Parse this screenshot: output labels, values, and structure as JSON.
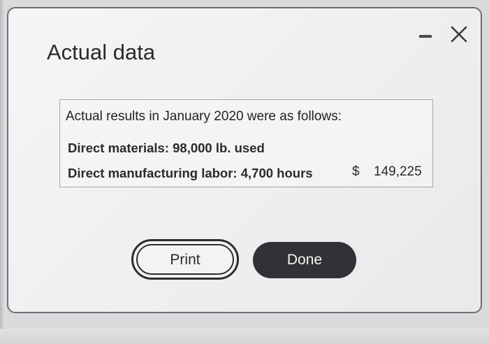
{
  "dialog": {
    "title": "Actual data",
    "minimize_icon": "minimize-icon",
    "close_icon": "close-icon"
  },
  "content": {
    "intro": "Actual results in January 2020 were as follows:",
    "lines": [
      {
        "label": "Direct materials: 98,000 lb. used",
        "currency": "",
        "amount": ""
      },
      {
        "label": "Direct manufacturing labor: 4,700 hours",
        "currency": "$",
        "amount": "149,225"
      }
    ]
  },
  "buttons": {
    "print_label": "Print",
    "done_label": "Done"
  },
  "colors": {
    "done_button_bg": "#323236",
    "dialog_border": "#6d6f72"
  }
}
